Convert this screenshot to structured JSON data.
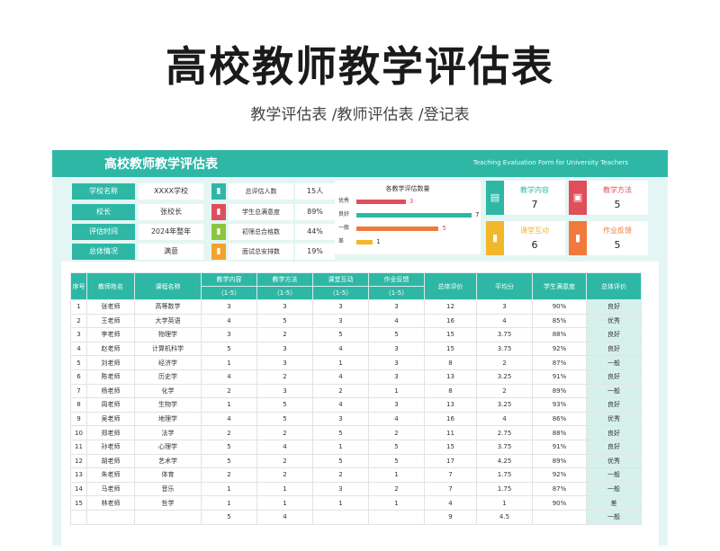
{
  "page": {
    "title": "高校教师教学评估表",
    "subtitle": "教学评估表 /教师评估表 /登记表"
  },
  "sheet": {
    "title": "高校教师教学评估表",
    "subtitle_en": "Teaching Evaluation Form for University Teachers"
  },
  "info": [
    {
      "label": "学校名称",
      "value": "XXXX学校"
    },
    {
      "label": "校长",
      "value": "张校长"
    },
    {
      "label": "评估时间",
      "value": "2024年整年"
    },
    {
      "label": "总体情况",
      "value": "满意"
    }
  ],
  "stats": [
    {
      "label": "总评估人数",
      "value": "15人",
      "icon": "bar-chart-icon",
      "color": "#2fb7a6"
    },
    {
      "label": "学生总满意度",
      "value": "89%",
      "icon": "bar-chart-icon",
      "color": "#e04e5c"
    },
    {
      "label": "初筛总合格数",
      "value": "44%",
      "icon": "bar-chart-icon",
      "color": "#8cc63f"
    },
    {
      "label": "面试总安排数",
      "value": "19%",
      "icon": "bar-chart-icon",
      "color": "#f3a32c"
    }
  ],
  "chart_data": {
    "type": "bar",
    "title": "各教学评估数量",
    "categories": [
      "优秀",
      "良好",
      "一般",
      "差"
    ],
    "values": [
      3,
      7,
      5,
      1
    ],
    "colors": [
      "#e04e5c",
      "#2fb7a6",
      "#f07a3c",
      "#f3b72c"
    ],
    "xlim": [
      0,
      7
    ]
  },
  "cards": [
    {
      "label": "教学内容",
      "value": "7",
      "color": "#2fb7a6",
      "icon": "book-icon"
    },
    {
      "label": "教学方法",
      "value": "5",
      "color": "#e04e5c",
      "icon": "briefcase-icon"
    },
    {
      "label": "课堂互动",
      "value": "6",
      "color": "#f3b72c",
      "icon": "bar-chart-icon"
    },
    {
      "label": "作业反馈",
      "value": "5",
      "color": "#f07a3c",
      "icon": "bar-chart-icon"
    }
  ],
  "table": {
    "headers": [
      "序号",
      "教师姓名",
      "课程名称",
      "教学内容",
      "教学方法",
      "课堂互动",
      "作业反馈",
      "总体评价",
      "平均分",
      "学生满意度",
      "总体评价"
    ],
    "range_label": "（1-5）",
    "rows": [
      [
        "1",
        "张老师",
        "高等数学",
        "3",
        "3",
        "3",
        "3",
        "12",
        "3",
        "90%",
        "良好"
      ],
      [
        "2",
        "王老师",
        "大学英语",
        "4",
        "5",
        "3",
        "4",
        "16",
        "4",
        "85%",
        "优秀"
      ],
      [
        "3",
        "李老师",
        "物理学",
        "3",
        "2",
        "5",
        "5",
        "15",
        "3.75",
        "88%",
        "良好"
      ],
      [
        "4",
        "赵老师",
        "计算机科学",
        "5",
        "3",
        "4",
        "3",
        "15",
        "3.75",
        "92%",
        "良好"
      ],
      [
        "5",
        "刘老师",
        "经济学",
        "1",
        "3",
        "1",
        "3",
        "8",
        "2",
        "87%",
        "一般"
      ],
      [
        "6",
        "陈老师",
        "历史学",
        "4",
        "2",
        "4",
        "3",
        "13",
        "3.25",
        "91%",
        "良好"
      ],
      [
        "7",
        "杨老师",
        "化学",
        "2",
        "3",
        "2",
        "1",
        "8",
        "2",
        "89%",
        "一般"
      ],
      [
        "8",
        "周老师",
        "生物学",
        "1",
        "5",
        "4",
        "3",
        "13",
        "3.25",
        "93%",
        "良好"
      ],
      [
        "9",
        "吴老师",
        "地理学",
        "4",
        "5",
        "3",
        "4",
        "16",
        "4",
        "86%",
        "优秀"
      ],
      [
        "10",
        "郑老师",
        "法学",
        "2",
        "2",
        "5",
        "2",
        "11",
        "2.75",
        "88%",
        "良好"
      ],
      [
        "11",
        "孙老师",
        "心理学",
        "5",
        "4",
        "1",
        "5",
        "15",
        "3.75",
        "91%",
        "良好"
      ],
      [
        "12",
        "胡老师",
        "艺术学",
        "5",
        "2",
        "5",
        "5",
        "17",
        "4.25",
        "89%",
        "优秀"
      ],
      [
        "13",
        "朱老师",
        "体育",
        "2",
        "2",
        "2",
        "1",
        "7",
        "1.75",
        "92%",
        "一般"
      ],
      [
        "14",
        "马老师",
        "音乐",
        "1",
        "1",
        "3",
        "2",
        "7",
        "1.75",
        "87%",
        "一般"
      ],
      [
        "15",
        "林老师",
        "哲学",
        "1",
        "1",
        "1",
        "1",
        "4",
        "1",
        "90%",
        "差"
      ],
      [
        "",
        "",
        "",
        "5",
        "4",
        "",
        "",
        "9",
        "4.5",
        "",
        "一般"
      ]
    ]
  }
}
